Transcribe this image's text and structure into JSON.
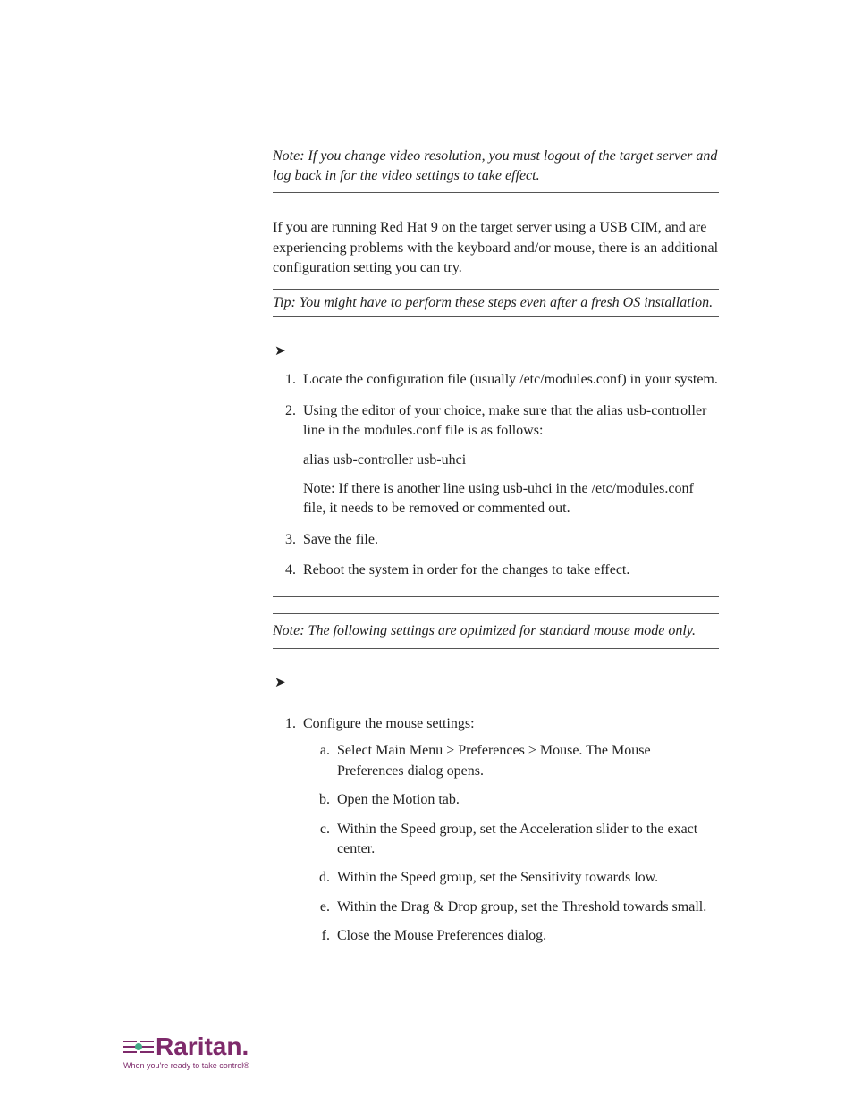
{
  "note1": "Note: If you change video resolution, you must logout of the target server and log back in for the video settings to take effect.",
  "intro": "If you are running Red Hat 9 on the target server using a USB CIM, and are experiencing problems with the keyboard and/or mouse, there is an additional configuration setting you can try.",
  "tip": "Tip: You might have to perform these steps even after a fresh OS installation.",
  "arrow1": "➤",
  "steps1": {
    "s1": "Locate the configuration file (usually /etc/modules.conf) in your system.",
    "s2": "Using the editor of your choice, make sure that the alias usb-controller line in the modules.conf file is as follows:",
    "s2a": "alias usb-controller usb-uhci",
    "s2b": "Note: If there is another line using usb-uhci in the /etc/modules.conf file, it needs to be removed or commented out.",
    "s3": "Save the file.",
    "s4": "Reboot the system in order for the changes to take effect."
  },
  "note2": "Note: The following settings are optimized for standard mouse mode only.",
  "arrow2": "➤",
  "steps2": {
    "s1": "Configure the mouse settings:",
    "a": "Select Main Menu > Preferences > Mouse. The Mouse Preferences dialog opens.",
    "b": "Open the Motion tab.",
    "c": "Within the Speed group, set the Acceleration slider to the exact center.",
    "d": "Within the Speed group, set the Sensitivity towards low.",
    "e": "Within the Drag & Drop group, set the Threshold towards small.",
    "f": "Close the Mouse Preferences dialog."
  },
  "logo": {
    "brand": "Raritan.",
    "tagline": "When you're ready to take control®"
  }
}
